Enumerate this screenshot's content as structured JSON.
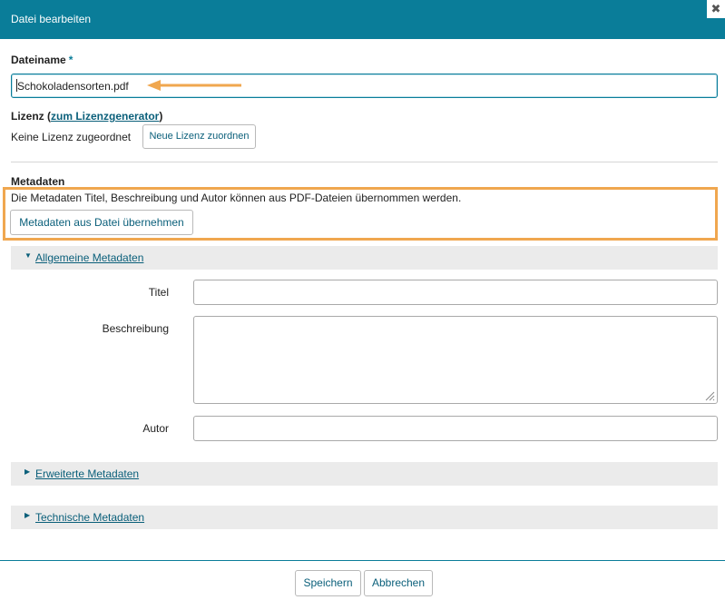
{
  "dialog": {
    "title": "Datei bearbeiten",
    "close_symbol": "✖"
  },
  "filename": {
    "label": "Dateiname",
    "required_marker": "*",
    "value": "Schokoladensorten.pdf"
  },
  "license": {
    "label_prefix": "Lizenz (",
    "generator_link": "zum Lizenzgenerator",
    "label_suffix": ")",
    "status": "Keine Lizenz zugeordnet",
    "assign_button": "Neue Lizenz zuordnen"
  },
  "metadata": {
    "heading": "Metadaten",
    "info": "Die Metadaten Titel, Beschreibung und Autor können aus PDF-Dateien übernommen werden.",
    "import_button": "Metadaten aus Datei übernehmen"
  },
  "sections": {
    "general": {
      "label": "Allgemeine Metadaten",
      "expanded": true,
      "toggle": "▼"
    },
    "extended": {
      "label": "Erweiterte Metadaten",
      "expanded": false,
      "toggle": "▶"
    },
    "technical": {
      "label": "Technische Metadaten",
      "expanded": false,
      "toggle": "▶"
    }
  },
  "fields": {
    "title_label": "Titel",
    "title_value": "",
    "description_label": "Beschreibung",
    "description_value": "",
    "author_label": "Autor",
    "author_value": ""
  },
  "footer": {
    "save_button": "Speichern",
    "cancel_button": "Abbrechen"
  },
  "colors": {
    "header": "#0a7d99",
    "highlight": "#f0a74f",
    "link": "#0a5f7a"
  }
}
